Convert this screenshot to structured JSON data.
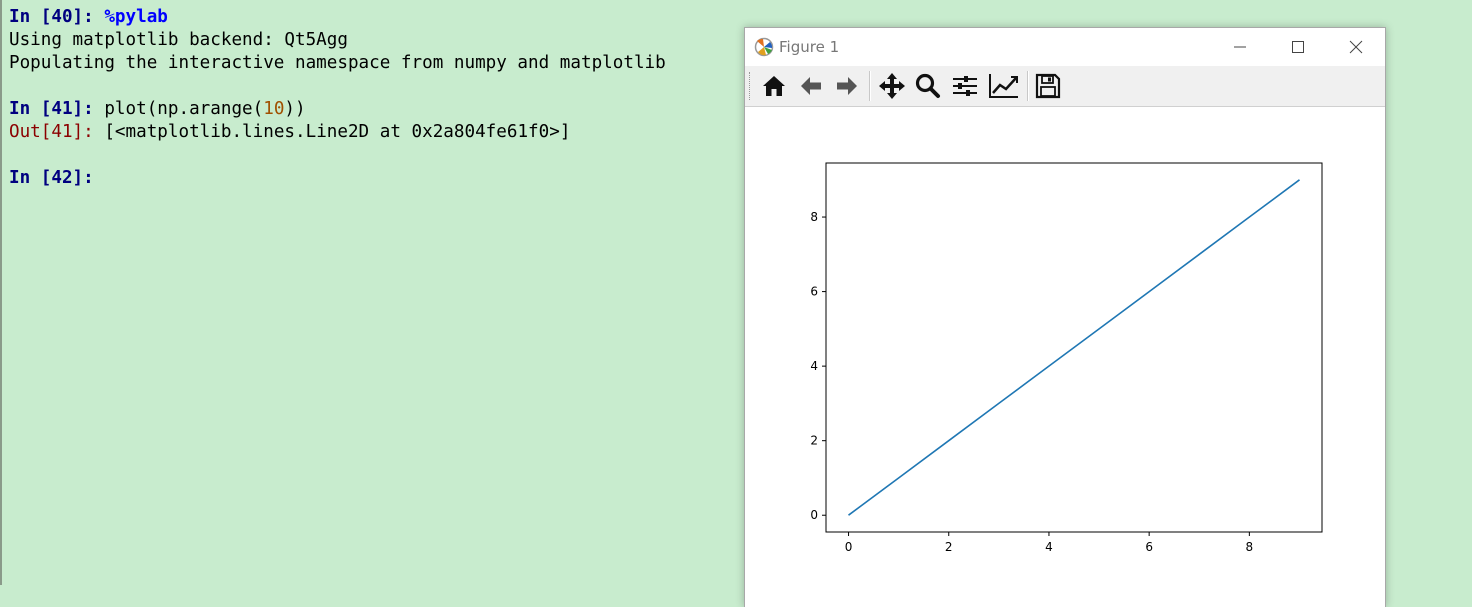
{
  "console": {
    "lines": [
      {
        "prompt_type": "in",
        "prompt": "In [40]:",
        "magic": "%pylab",
        "text": ""
      },
      {
        "prompt_type": "output",
        "text": "Using matplotlib backend: Qt5Agg"
      },
      {
        "prompt_type": "output",
        "text": "Populating the interactive namespace from numpy and matplotlib"
      },
      {
        "prompt_type": "in",
        "prompt": "In [41]:",
        "code_before": "plot(np.arange(",
        "code_num": "10",
        "code_after": "))"
      },
      {
        "prompt_type": "out",
        "prompt": "Out[41]:",
        "text": "[<matplotlib.lines.Line2D at 0x2a804fe61f0>]"
      },
      {
        "prompt_type": "in",
        "prompt": "In [42]:",
        "text": ""
      }
    ]
  },
  "figure_window": {
    "title": "Figure 1",
    "toolbar": [
      {
        "name": "home-icon"
      },
      {
        "name": "back-arrow-icon"
      },
      {
        "name": "forward-arrow-icon"
      },
      {
        "name": "pan-icon"
      },
      {
        "name": "zoom-icon"
      },
      {
        "name": "subplots-config-icon"
      },
      {
        "name": "edit-axes-icon"
      },
      {
        "name": "save-icon"
      }
    ]
  },
  "colors": {
    "line": "#1f77b4",
    "console_bg": "#c8ecce"
  },
  "chart_data": {
    "type": "line",
    "x": [
      0,
      1,
      2,
      3,
      4,
      5,
      6,
      7,
      8,
      9
    ],
    "series": [
      {
        "values": [
          0,
          1,
          2,
          3,
          4,
          5,
          6,
          7,
          8,
          9
        ]
      }
    ],
    "xticks": [
      "0",
      "2",
      "4",
      "6",
      "8"
    ],
    "yticks": [
      "0",
      "2",
      "4",
      "6",
      "8"
    ],
    "xlim": [
      -0.45,
      9.45
    ],
    "ylim": [
      -0.45,
      9.45
    ],
    "grid": false,
    "title": "",
    "xlabel": "",
    "ylabel": ""
  }
}
